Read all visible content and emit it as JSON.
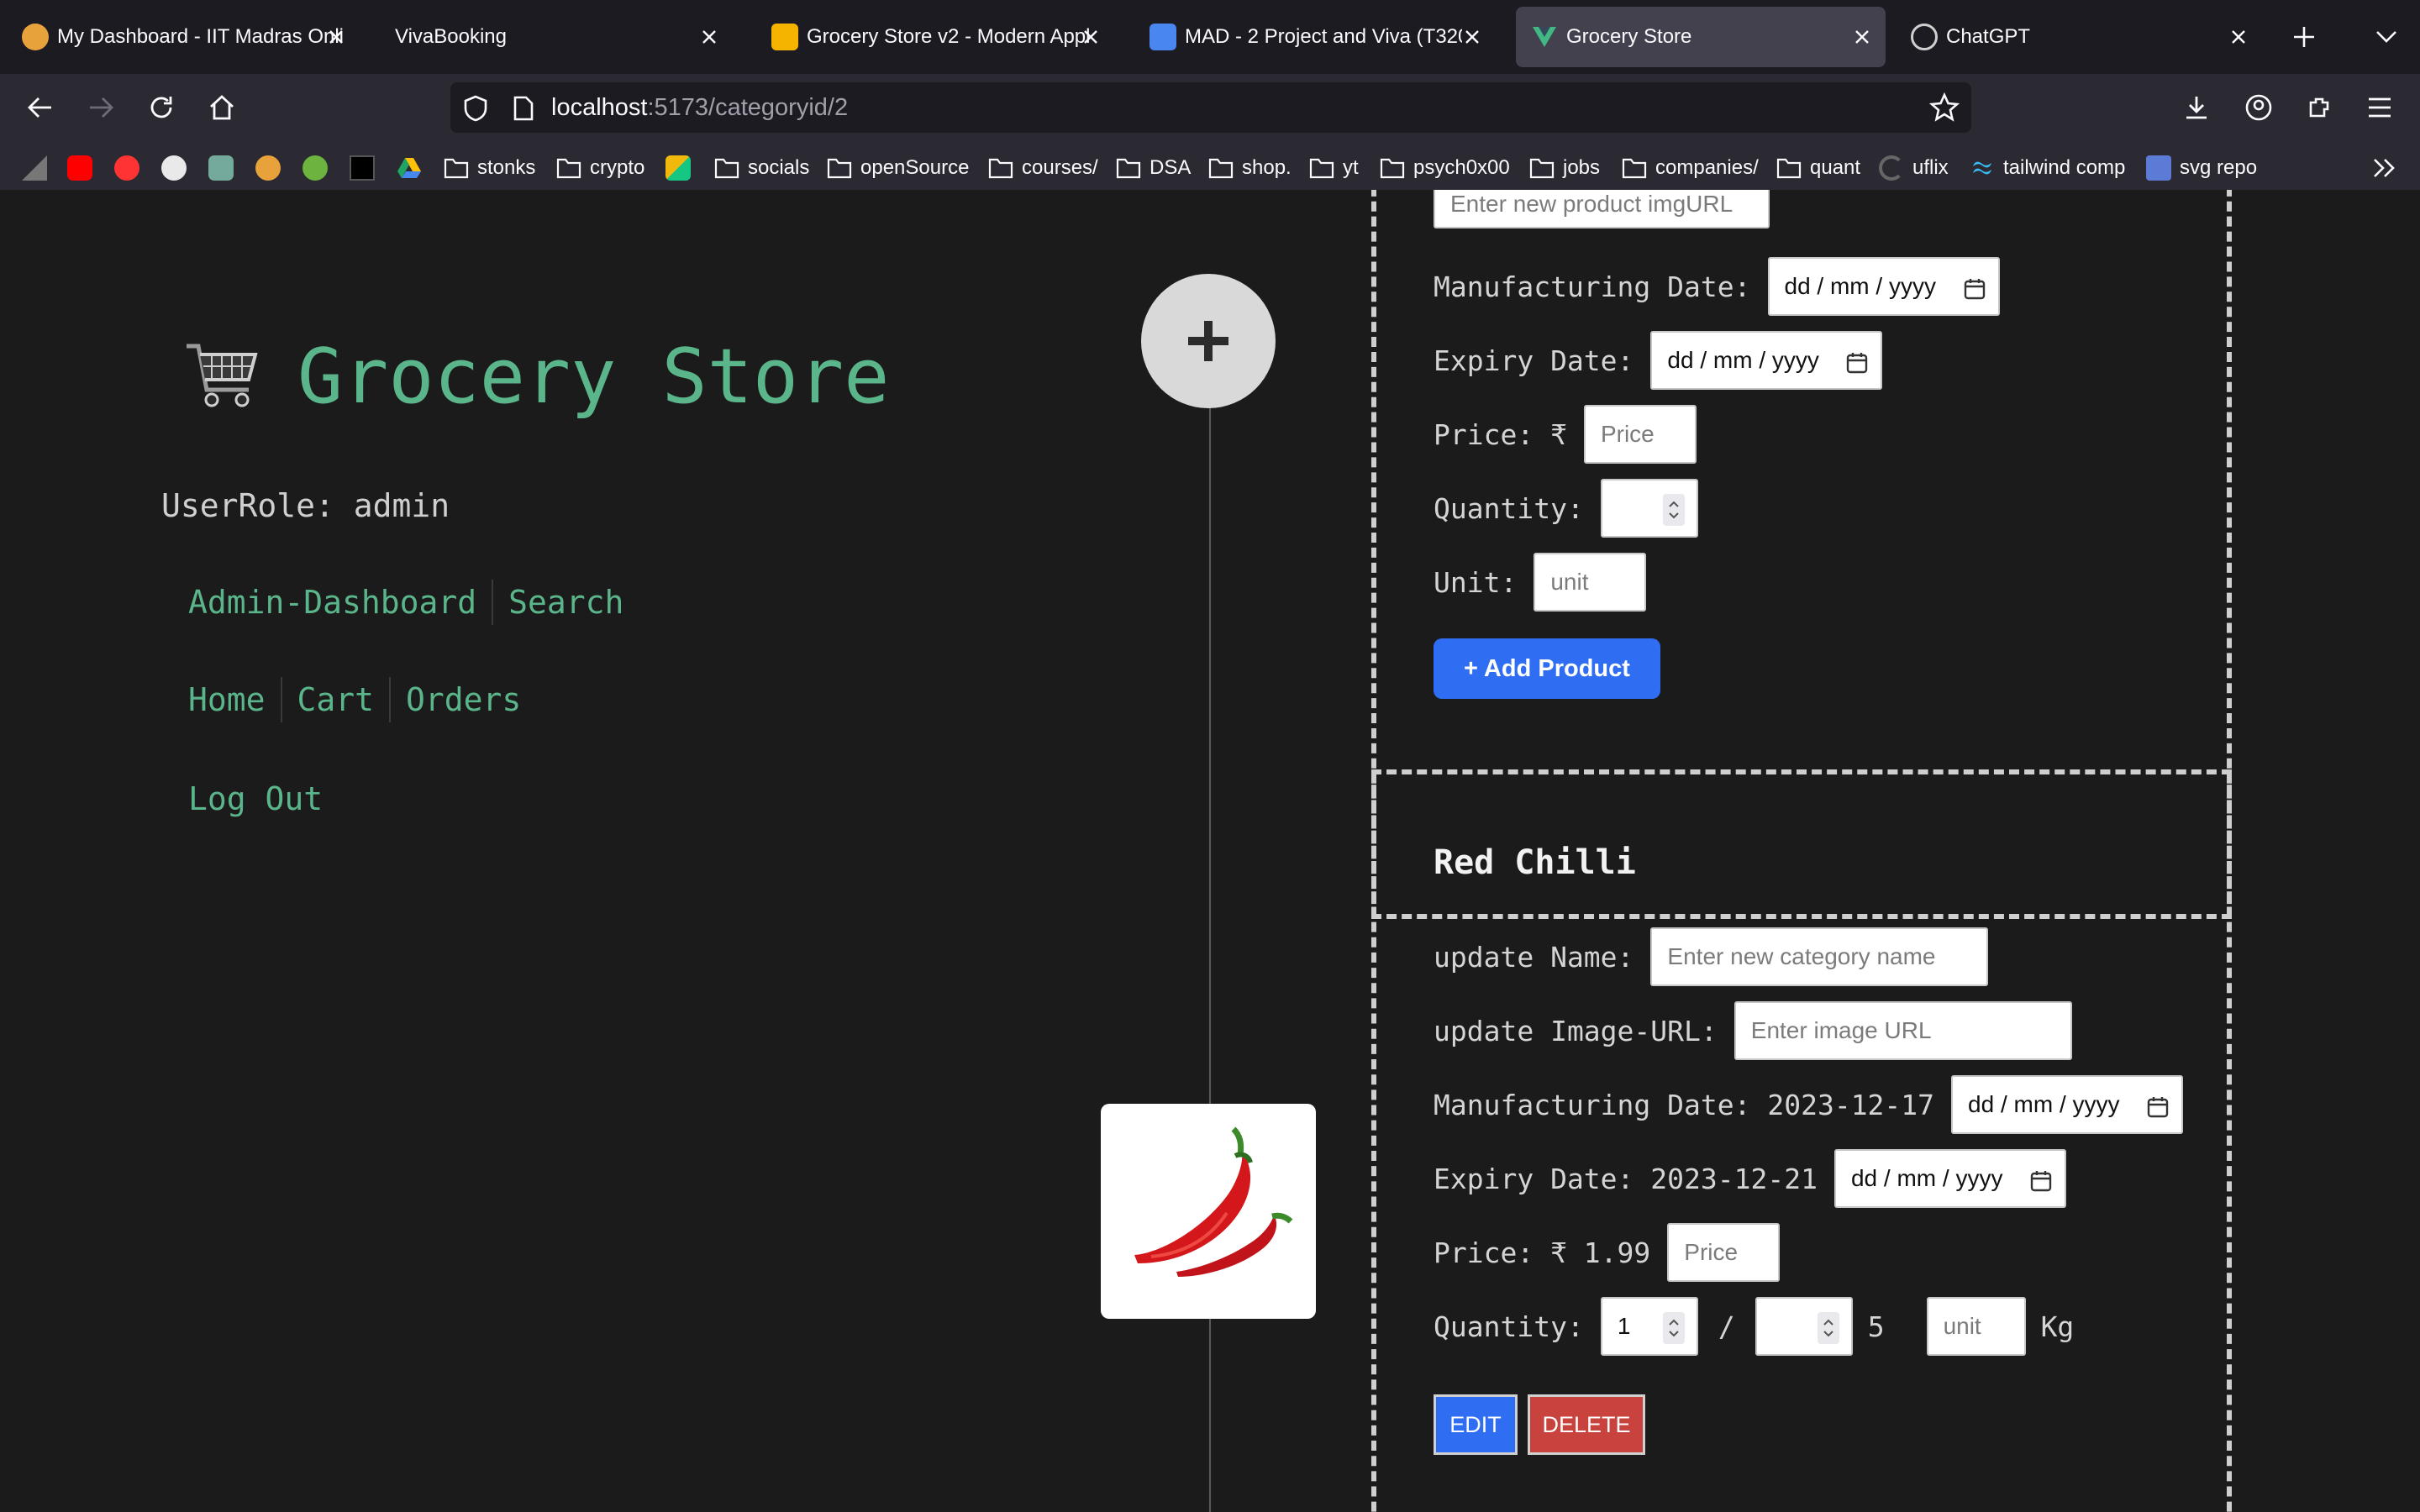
{
  "browser": {
    "tabs": [
      {
        "title": "My Dashboard - IIT Madras Onli",
        "icon": "iitm-favicon-icon",
        "active": false
      },
      {
        "title": "VivaBooking",
        "icon": "",
        "active": false
      },
      {
        "title": "Grocery Store v2 - Modern Appl",
        "icon": "google-slides-icon",
        "active": false
      },
      {
        "title": "MAD - 2 Project and Viva (T320",
        "icon": "google-docs-icon",
        "active": false
      },
      {
        "title": "Grocery Store",
        "icon": "vue-icon",
        "active": true
      },
      {
        "title": "ChatGPT",
        "icon": "chatgpt-icon",
        "active": false
      }
    ],
    "url_host": "localhost",
    "url_path": ":5173/categoryid/2",
    "bookmarks": {
      "stonks": "stonks",
      "crypto": "crypto",
      "socials": "socials",
      "opensource": "openSource",
      "courses": "courses/",
      "dsa": "DSA",
      "shop": "shop.",
      "yt": "yt",
      "psych": "psych0x00",
      "jobs": "jobs",
      "companies": "companies/",
      "quant": "quant",
      "uflix": "uflix",
      "tailwind": "tailwind comp",
      "svgrepo": "svg repo"
    }
  },
  "sidebar": {
    "title": "Grocery Store",
    "user_role": "UserRole: admin",
    "links_row1": {
      "admin_dashboard": "Admin-Dashboard",
      "search": "Search"
    },
    "links_row2": {
      "home": "Home",
      "cart": "Cart",
      "orders": "Orders"
    },
    "logout": "Log Out"
  },
  "new_product_form": {
    "img_url_placeholder": "Enter new product imgURL",
    "mfg_label": "Manufacturing Date:",
    "expiry_label": "Expiry Date:",
    "date_placeholder": "dd / mm / yyyy",
    "price_label": "Price: ₹",
    "price_placeholder": "Price",
    "quantity_label": "Quantity:",
    "unit_label": "Unit:",
    "unit_placeholder": "unit",
    "add_button": "+ Add Product"
  },
  "product": {
    "name": "Red Chilli",
    "update_name_label": "update Name:",
    "update_name_placeholder": "Enter new category name",
    "update_image_label": "update Image-URL:",
    "update_image_placeholder": "Enter image URL",
    "mfg_label": "Manufacturing Date: 2023-12-17",
    "expiry_label": "Expiry Date: 2023-12-21",
    "date_placeholder": "dd / mm / yyyy",
    "price_label": "Price: ₹ 1.99",
    "price_placeholder": "Price",
    "quantity_label": "Quantity:",
    "quantity_value": "1",
    "slash": "/",
    "stock": "5",
    "unit_placeholder": "unit",
    "unit": "Kg",
    "edit_button": "EDIT",
    "delete_button": "DELETE"
  },
  "colors": {
    "accent_green": "#5bb58a",
    "primary_blue": "#2f6ef2",
    "danger_red": "#c9433e",
    "page_bg": "#1b1b1b"
  }
}
